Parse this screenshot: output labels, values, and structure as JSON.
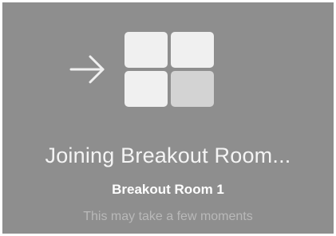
{
  "dialog": {
    "icons": {
      "arrow": "arrow-right-icon",
      "rooms": "breakout-rooms-grid-icon"
    },
    "title": "Joining Breakout Room...",
    "room_name": "Breakout Room 1",
    "subtitle": "This may take a few moments"
  },
  "colors": {
    "background": "#8e8e8e",
    "tile": "#f0f0f0",
    "tile_highlight": "#d3d3d3",
    "title_text": "#f4f4f4",
    "subtitle_text": "#b9b9b9"
  }
}
